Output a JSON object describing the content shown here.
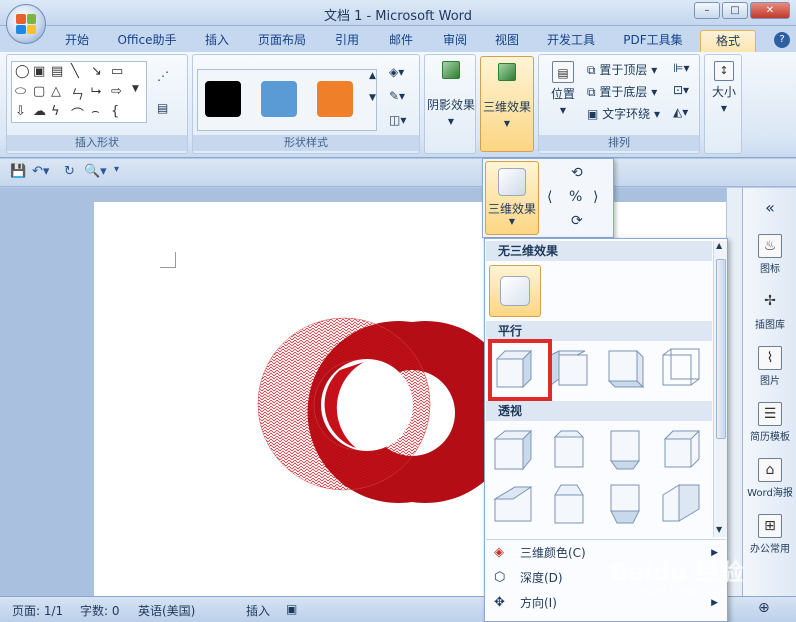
{
  "window": {
    "title": "文档 1 - Microsoft Word",
    "minimize": "–",
    "maximize": "□",
    "close": "✕"
  },
  "tabs": [
    "开始",
    "Office助手",
    "插入",
    "页面布局",
    "引用",
    "邮件",
    "审阅",
    "视图",
    "开发工具",
    "PDF工具集",
    "格式"
  ],
  "active_tab": "格式",
  "help": "?",
  "ribbon": {
    "groups": {
      "insert_shapes": "插入形状",
      "shape_styles": "形状样式",
      "arrange": "排列"
    },
    "style_swatches": [
      "#000000",
      "#5b9bd5",
      "#f07f2a"
    ],
    "shadow_effects": "阴影效果",
    "three_d_effects": "三维效果",
    "position": "位置",
    "bring_to_front": "置于顶层",
    "send_to_back": "置于底层",
    "text_wrap": "文字环绕",
    "size": "大小"
  },
  "popup": {
    "three_d_button": "三维效果",
    "sections": {
      "none": "无三维效果",
      "parallel": "平行",
      "perspective": "透视"
    },
    "menu_items": [
      {
        "label": "三维颜色(C)",
        "icon": "paint-bucket-icon"
      },
      {
        "label": "深度(D)",
        "icon": "depth-icon"
      },
      {
        "label": "方向(I)",
        "icon": "direction-icon"
      }
    ]
  },
  "side_panel": {
    "collapse": "«",
    "items": [
      "图标",
      "插图库",
      "图片",
      "简历模板",
      "Word海报",
      "办公常用"
    ]
  },
  "status": {
    "page": "页面: 1/1",
    "words": "字数: 0",
    "language": "英语(美国)",
    "mode": "插入"
  },
  "watermark": {
    "brand": "Baidu 经验",
    "url": "jingyan.baidu.com"
  },
  "colors": {
    "ring_red": "#c8101a",
    "highlight_red": "#e02a2a",
    "active_gold": "#fbd683"
  }
}
